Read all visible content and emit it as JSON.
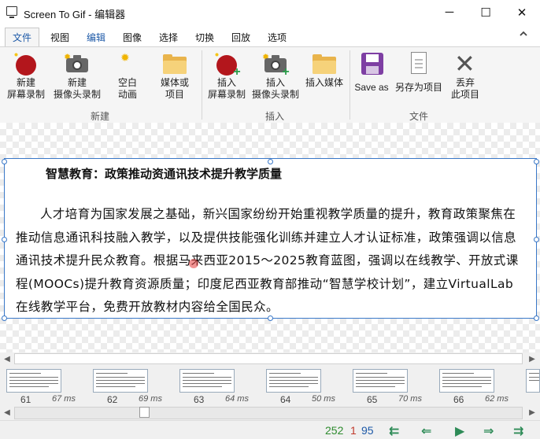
{
  "window": {
    "title": "Screen To Gif - 编辑器"
  },
  "menu_tabs": [
    "文件",
    "视图",
    "编辑",
    "图像",
    "选择",
    "切换",
    "回放",
    "选项"
  ],
  "ribbon": {
    "new_group": {
      "label": "新建",
      "buttons": [
        {
          "label": "新建\n屏幕录制",
          "icon": "record-icon"
        },
        {
          "label": "新建\n摄像头录制",
          "icon": "camera-icon"
        },
        {
          "label": "空白\n动画",
          "icon": "blank-icon"
        },
        {
          "label": "媒体或\n项目",
          "icon": "folder-icon"
        }
      ]
    },
    "insert_group": {
      "label": "插入",
      "buttons": [
        {
          "label": "插入\n屏幕录制",
          "icon": "record-plus-icon"
        },
        {
          "label": "插入\n摄像头录制",
          "icon": "camera-plus-icon"
        },
        {
          "label": "插入媒体",
          "icon": "folder-icon"
        }
      ]
    },
    "file_group": {
      "label": "文件",
      "buttons": [
        {
          "label": "Save as",
          "icon": "save-icon"
        },
        {
          "label": "另存为项目",
          "icon": "project-icon"
        },
        {
          "label": "丢弃\n此项目",
          "icon": "discard-icon"
        }
      ]
    }
  },
  "document": {
    "title": "智慧教育：政策推动资通讯技术提升教学质量",
    "paragraph": "人才培育为国家发展之基础，新兴国家纷纷开始重视教学质量的提升，教育政策聚焦在推动信息通讯科技融入教学，以及提供技能强化训练并建立人才认证标准，政策强调以信息通讯技术提升民众教育。根据马来西亚2015～2025教育蓝图，强调以在线教学、开放式课程(MOOCs)提升教育资源质量；印度尼西亚教育部推动“智慧学校计划”，建立VirtualLab在线教学平台，免费开放教材内容给全国民众。"
  },
  "frames": [
    {
      "number": "61",
      "duration": "67 ms"
    },
    {
      "number": "62",
      "duration": "69 ms"
    },
    {
      "number": "63",
      "duration": "64 ms"
    },
    {
      "number": "64",
      "duration": "50 ms"
    },
    {
      "number": "65",
      "duration": "70 ms"
    },
    {
      "number": "66",
      "duration": "62 ms"
    }
  ],
  "status": {
    "total_frames": "252",
    "selected": "1",
    "current": "95"
  },
  "colors": {
    "total": "#2e8b2e",
    "selected": "#c0392b",
    "current": "#1e5aa8",
    "accent": "#1e5aa8"
  }
}
